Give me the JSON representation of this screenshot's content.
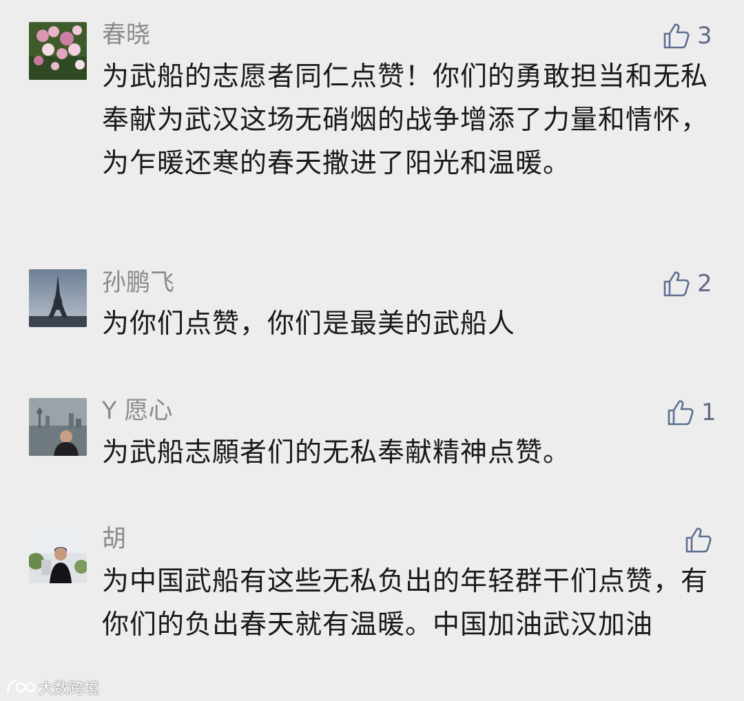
{
  "comments": [
    {
      "name": "春晓",
      "likes": "3",
      "text": "为武船的志愿者同仁点赞！你们的勇敢担当和无私奉献为武汉这场无硝烟的战争增添了力量和情怀，为乍暖还寒的春天撒进了阳光和温暖。",
      "avatar_icon": "flower-photo-avatar"
    },
    {
      "name": "孙鹏飞",
      "likes": "2",
      "text": "为你们点赞，你们是最美的武船人",
      "avatar_icon": "eiffel-tower-photo-avatar"
    },
    {
      "name": "Y 愿心",
      "likes": "1",
      "text": "为武船志願者们的无私奉献精神点赞。",
      "avatar_icon": "city-skyline-portrait-avatar"
    },
    {
      "name": "胡",
      "likes": "",
      "text": "为中国武船有这些无私负出的年轻群干们点赞，有你们的负出春天就有温暖。中国加油武汉加油",
      "avatar_icon": "outdoor-portrait-avatar"
    }
  ],
  "like_icon": "thumbs-up-icon",
  "watermark": {
    "text": "大数跨境",
    "icon": "brand-logo-icon"
  }
}
